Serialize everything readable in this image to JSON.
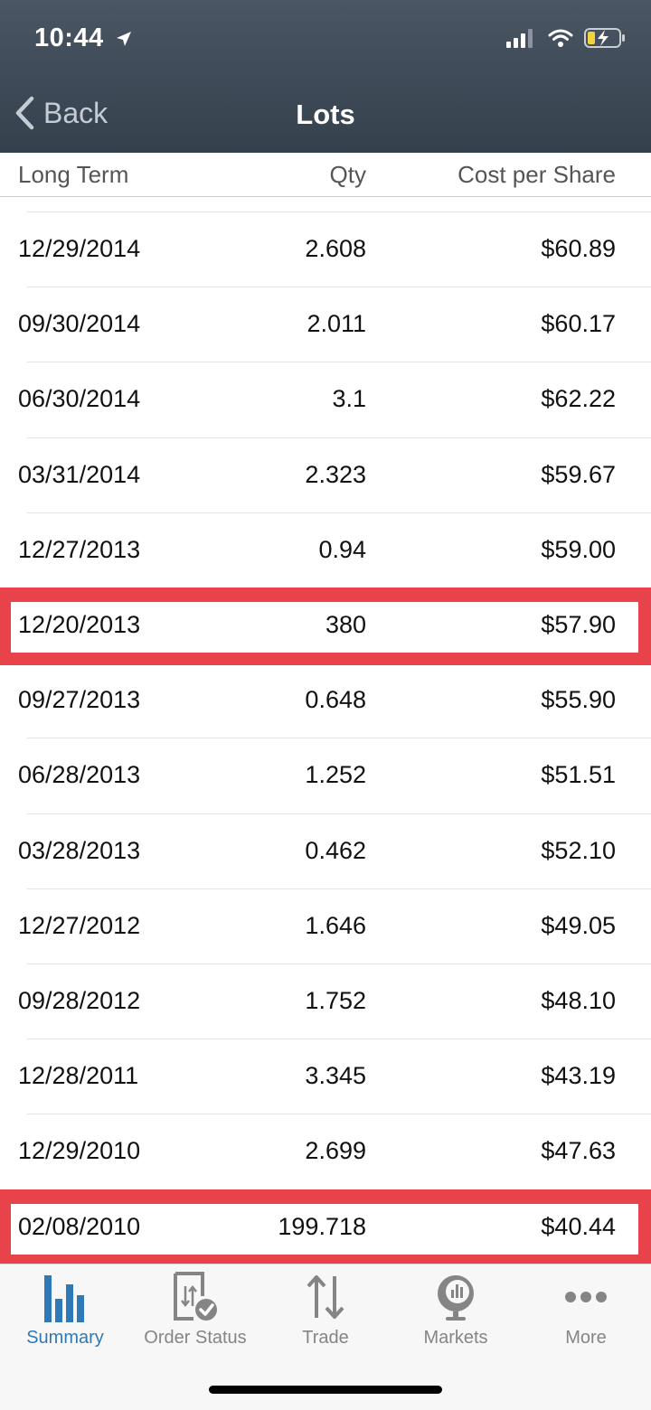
{
  "status_bar": {
    "time": "10:44"
  },
  "nav": {
    "back_label": "Back",
    "title": "Lots"
  },
  "columns": {
    "date": "Long Term",
    "qty": "Qty",
    "cost": "Cost per Share"
  },
  "rows": [
    {
      "date": "12/29/2014",
      "qty": "2.608",
      "cost": "$60.89",
      "highlighted": false
    },
    {
      "date": "09/30/2014",
      "qty": "2.011",
      "cost": "$60.17",
      "highlighted": false
    },
    {
      "date": "06/30/2014",
      "qty": "3.1",
      "cost": "$62.22",
      "highlighted": false
    },
    {
      "date": "03/31/2014",
      "qty": "2.323",
      "cost": "$59.67",
      "highlighted": false
    },
    {
      "date": "12/27/2013",
      "qty": "0.94",
      "cost": "$59.00",
      "highlighted": false
    },
    {
      "date": "12/20/2013",
      "qty": "380",
      "cost": "$57.90",
      "highlighted": true
    },
    {
      "date": "09/27/2013",
      "qty": "0.648",
      "cost": "$55.90",
      "highlighted": false
    },
    {
      "date": "06/28/2013",
      "qty": "1.252",
      "cost": "$51.51",
      "highlighted": false
    },
    {
      "date": "03/28/2013",
      "qty": "0.462",
      "cost": "$52.10",
      "highlighted": false
    },
    {
      "date": "12/27/2012",
      "qty": "1.646",
      "cost": "$49.05",
      "highlighted": false
    },
    {
      "date": "09/28/2012",
      "qty": "1.752",
      "cost": "$48.10",
      "highlighted": false
    },
    {
      "date": "12/28/2011",
      "qty": "3.345",
      "cost": "$43.19",
      "highlighted": false
    },
    {
      "date": "12/29/2010",
      "qty": "2.699",
      "cost": "$47.63",
      "highlighted": false
    },
    {
      "date": "02/08/2010",
      "qty": "199.718",
      "cost": "$40.44",
      "highlighted": true
    }
  ],
  "tabs": [
    {
      "label": "Summary",
      "icon": "bar-chart-icon",
      "active": true
    },
    {
      "label": "Order Status",
      "icon": "order-status-icon",
      "active": false
    },
    {
      "label": "Trade",
      "icon": "trade-arrows-icon",
      "active": false
    },
    {
      "label": "Markets",
      "icon": "globe-chart-icon",
      "active": false
    },
    {
      "label": "More",
      "icon": "more-dots-icon",
      "active": false
    }
  ],
  "colors": {
    "header": "#3d4955",
    "accent": "#2f79b7",
    "highlight": "#e8424b",
    "tab_inactive": "#858585"
  }
}
